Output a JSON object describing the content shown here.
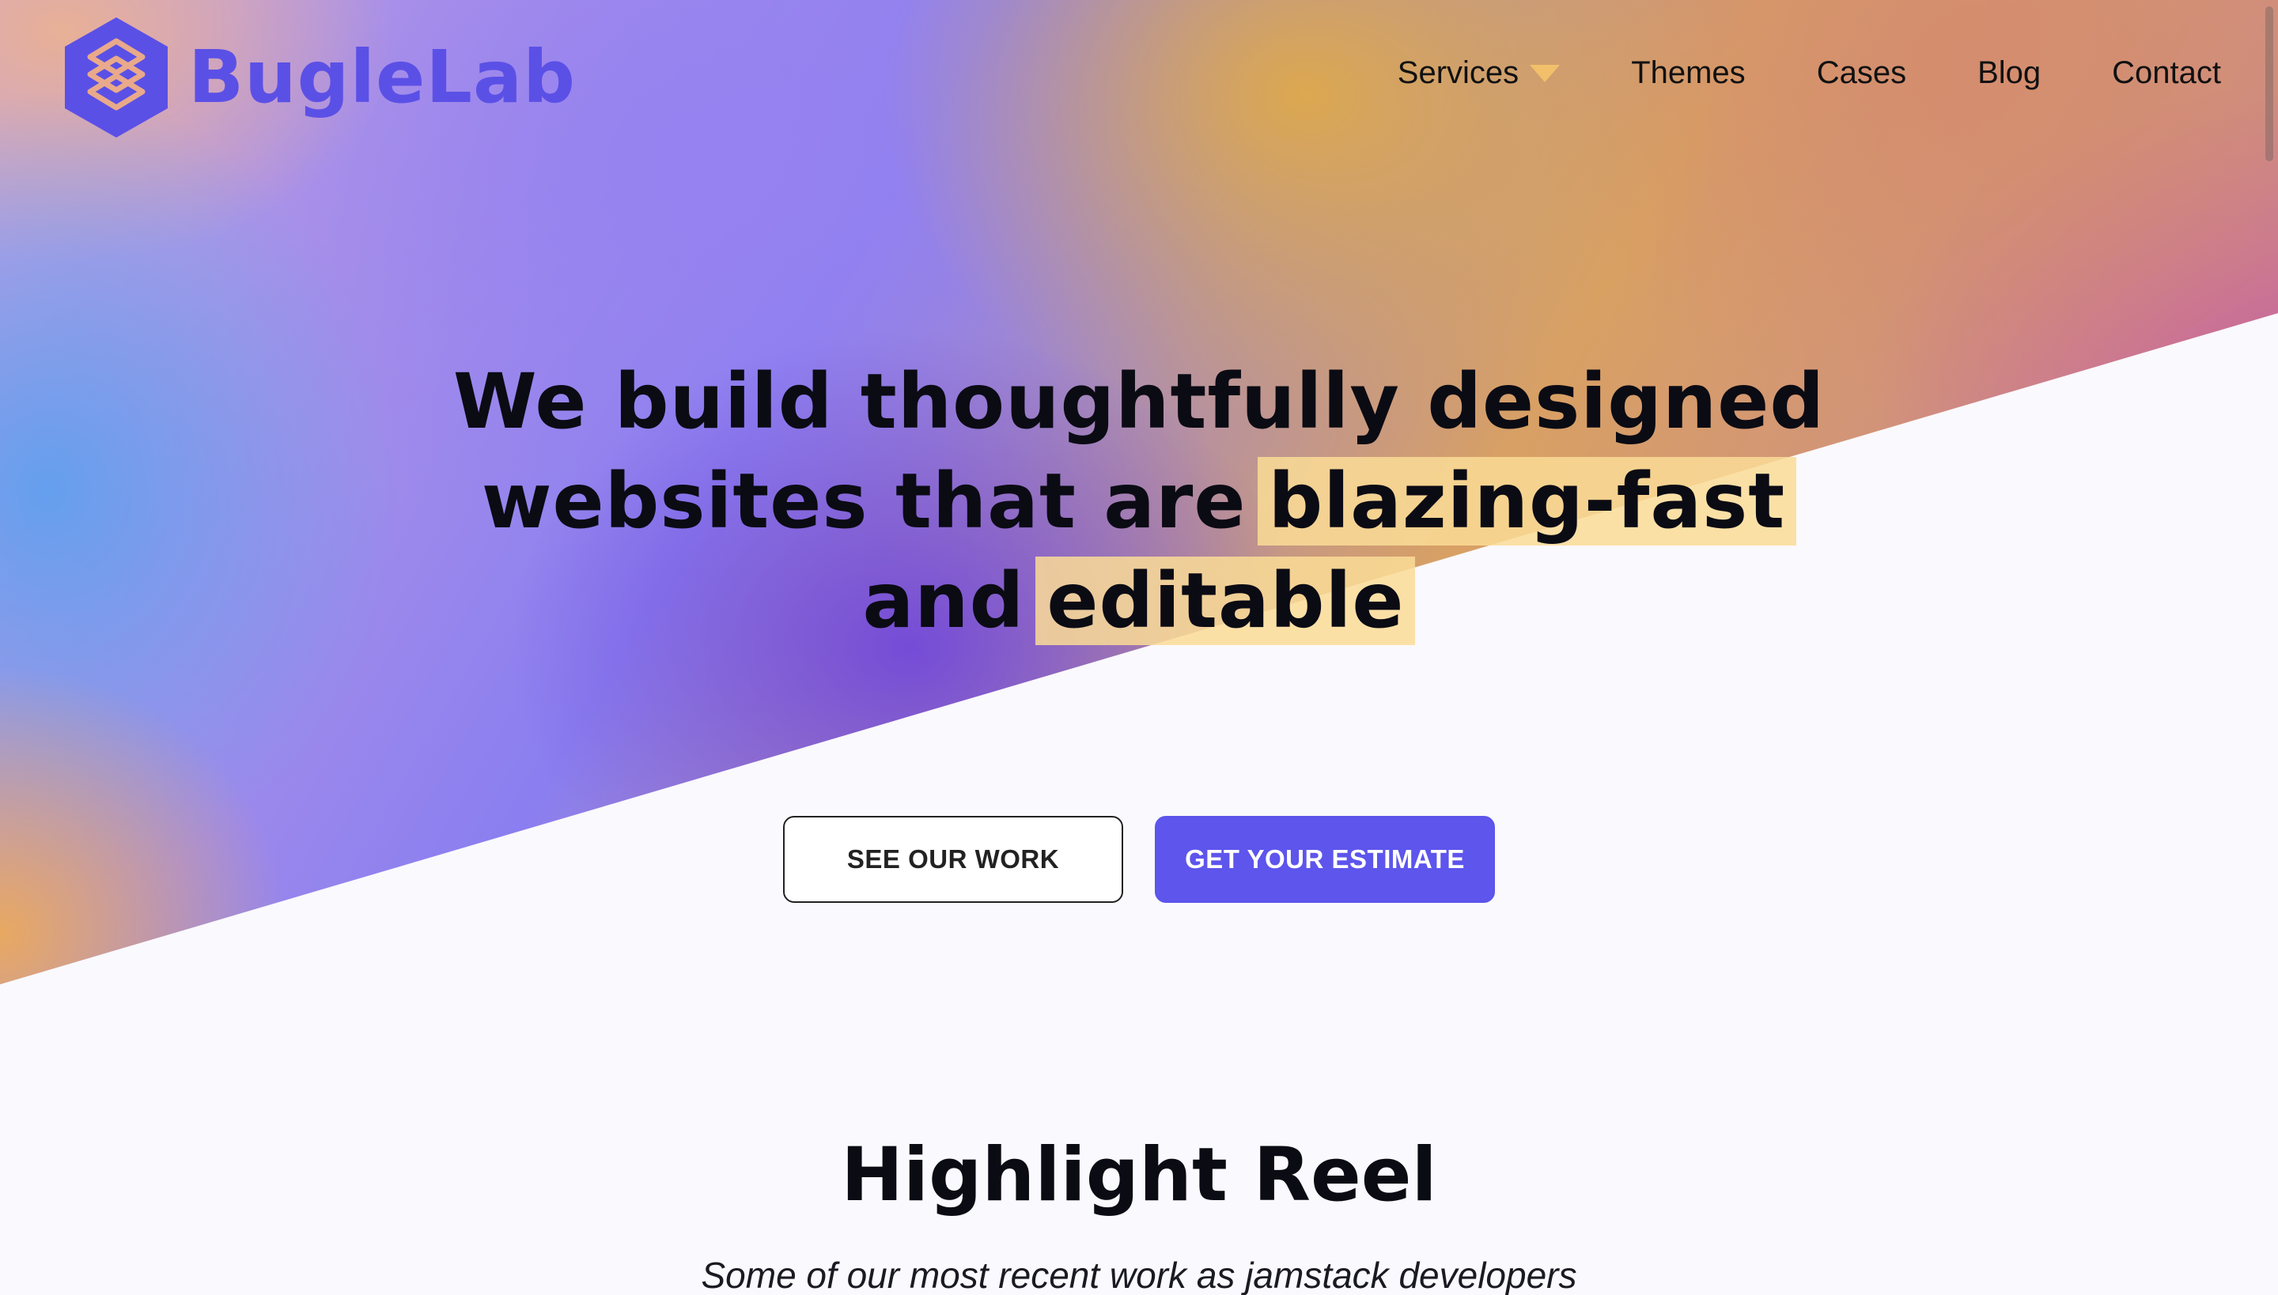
{
  "header": {
    "logo_text": "BugleLab",
    "nav": [
      {
        "label": "Services",
        "has_dropdown": true
      },
      {
        "label": "Themes"
      },
      {
        "label": "Cases"
      },
      {
        "label": "Blog"
      },
      {
        "label": "Contact"
      }
    ]
  },
  "hero": {
    "title_line1": "We build thoughtfully designed",
    "title_line2_prefix": "websites that are",
    "title_line2_highlight": "blazing-fast",
    "title_line3_prefix": "and",
    "title_line3_highlight": "editable",
    "cta_secondary": "SEE OUR WORK",
    "cta_primary": "GET YOUR ESTIMATE"
  },
  "highlight_reel": {
    "title": "Highlight Reel",
    "subtitle": "Some of our most recent work as jamstack developers"
  },
  "colors": {
    "brand": "#5b50e6",
    "primary_button": "#5d55ec",
    "highlight": "#fadc96",
    "dropdown_caret": "#f2c06a"
  },
  "icons": {
    "logo": "hexagon-logo-icon",
    "dropdown": "chevron-down-icon"
  }
}
